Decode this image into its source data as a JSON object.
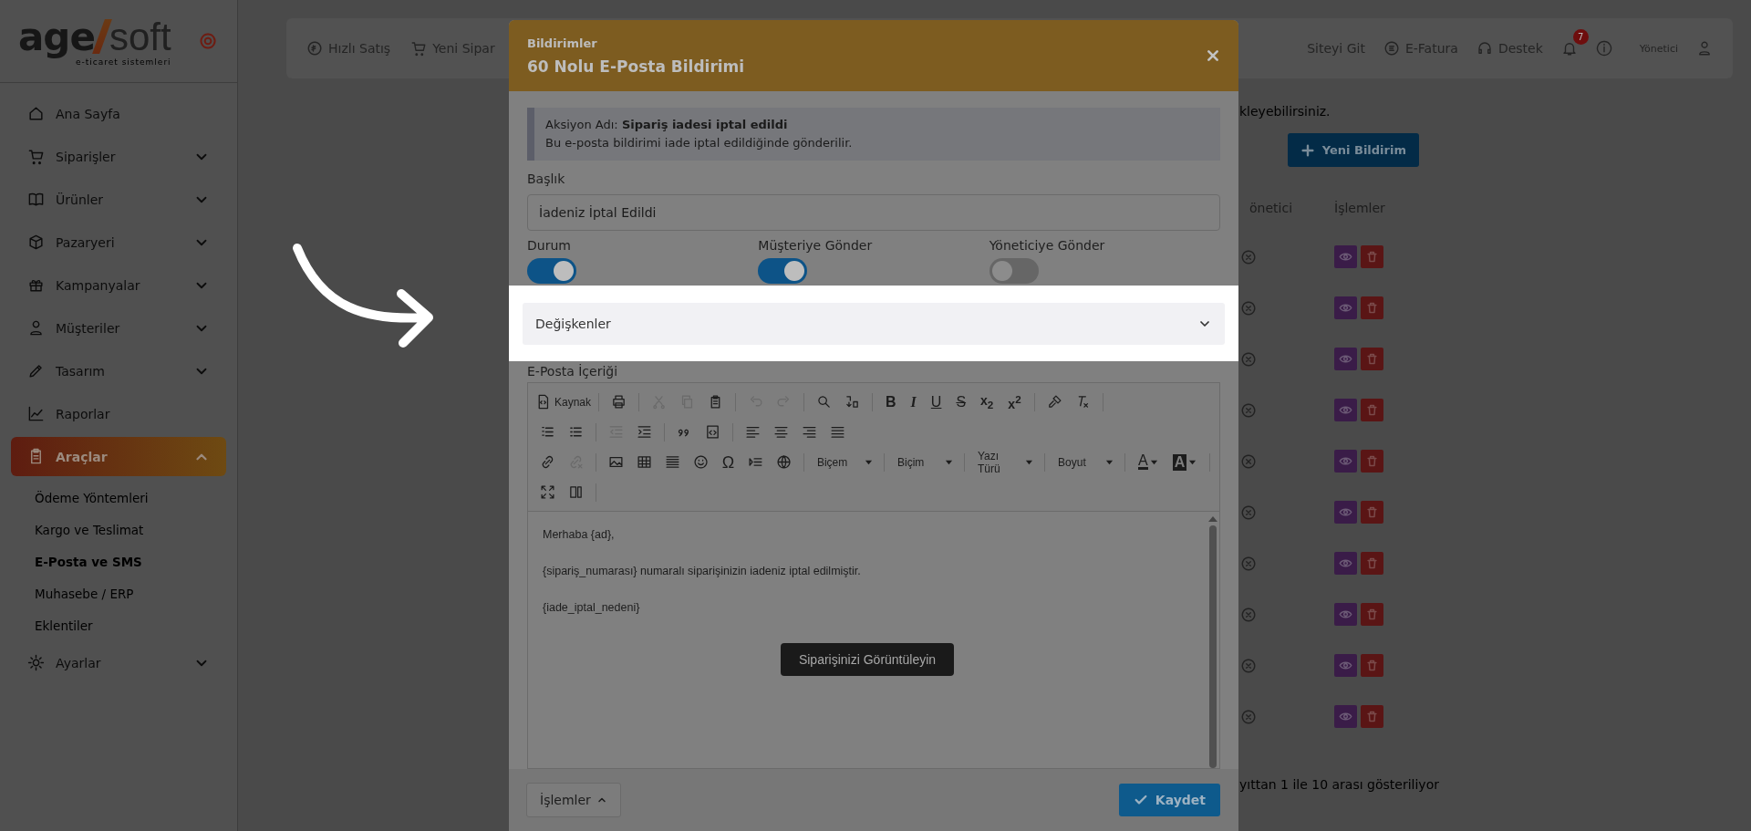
{
  "logo": {
    "brand_left": "age",
    "brand_right": "soft",
    "tagline": "e-ticaret sistemleri"
  },
  "sidebar": {
    "items": [
      {
        "label": "Ana Sayfa",
        "expandable": false,
        "selected": false
      },
      {
        "label": "Siparişler",
        "expandable": true,
        "expanded": false,
        "selected": false
      },
      {
        "label": "Ürünler",
        "expandable": true,
        "expanded": false,
        "selected": false
      },
      {
        "label": "Pazaryeri",
        "expandable": true,
        "expanded": false,
        "selected": false
      },
      {
        "label": "Kampanyalar",
        "expandable": true,
        "expanded": false,
        "selected": false
      },
      {
        "label": "Müşteriler",
        "expandable": true,
        "expanded": false,
        "selected": false
      },
      {
        "label": "Tasarım",
        "expandable": true,
        "expanded": false,
        "selected": false
      },
      {
        "label": "Raporlar",
        "expandable": false,
        "selected": false
      },
      {
        "label": "Araçlar",
        "expandable": true,
        "expanded": true,
        "selected": true,
        "children": [
          {
            "label": "Ödeme Yöntemleri",
            "selected": false
          },
          {
            "label": "Kargo ve Teslimat",
            "selected": false
          },
          {
            "label": "E-Posta ve SMS",
            "selected": true
          },
          {
            "label": "Muhasebe / ERP",
            "selected": false
          },
          {
            "label": "Eklentiler",
            "selected": false
          }
        ]
      },
      {
        "label": "Ayarlar",
        "expandable": true,
        "expanded": false,
        "selected": false
      }
    ]
  },
  "topbar": {
    "left": [
      "Hızlı Satış",
      "Yeni Sipar"
    ],
    "right": [
      "Siteyi Git",
      "E-Fatura",
      "Destek"
    ],
    "notification_count": "7",
    "user": "Yönetici"
  },
  "page": {
    "hint": "kleyebilirsiniz.",
    "new_button": "Yeni Bildirim",
    "table": {
      "columns": [
        "önetici",
        "İşlemler"
      ],
      "rows": [
        {
          "admin": false
        },
        {
          "admin": false
        },
        {
          "admin": false
        },
        {
          "admin": false
        },
        {
          "admin": false
        },
        {
          "admin": false
        },
        {
          "admin": false
        },
        {
          "admin": false
        },
        {
          "admin": false
        },
        {
          "admin": false
        }
      ]
    },
    "footer": "yıttan 1 ile 10 arası gösteriliyor"
  },
  "modal": {
    "eyebrow": "Bildirimler",
    "title": "60 Nolu E-Posta Bildirimi",
    "info": {
      "line": "Aksiyon Adı: **Sipariş iadesi iptal edildi**",
      "description": "Bu e-posta bildirimi iade iptal edildiğinde gönderilir."
    },
    "title_field": {
      "label": "Başlık",
      "value": "İadeniz İptal Edildi"
    },
    "toggles": [
      {
        "label": "Durum",
        "on": true
      },
      {
        "label": "Müşteriye Gönder",
        "on": true
      },
      {
        "label": "Yöneticiye Gönder",
        "on": false
      }
    ],
    "variables_select": {
      "value": "Değişkenler"
    },
    "content_label": "E-Posta İçeriği",
    "editor": {
      "source_label": "Kaynak",
      "glyphs": [
        {
          "text": "B",
          "kind": "bold"
        },
        {
          "text": "I",
          "kind": "italic"
        },
        {
          "text": "U",
          "kind": "underline"
        },
        {
          "text": "S",
          "kind": "strike"
        },
        {
          "text": "x$_{2}$",
          "kind": "sub"
        },
        {
          "text": "x$^{2}$",
          "kind": "sup"
        },
        {
          "text": "Ω",
          "kind": "symbol"
        },
        {
          "text": "A",
          "kind": "text-color"
        },
        {
          "text": "A",
          "kind": "background-color"
        }
      ],
      "dropdowns": [
        "Biçem",
        "Biçim",
        "Yazı Türü",
        "Boyut"
      ],
      "paragraphs": [
        "Merhaba {ad},",
        "{sipariş_numarası} numaralı siparişinizin iadeniz iptal edilmiştir.",
        "{iade_iptal_nedeni}"
      ],
      "button": "Siparişinizi Görüntüleyin"
    },
    "footer": {
      "actions_button": "İşlemler",
      "save_button": "Kaydet"
    }
  }
}
